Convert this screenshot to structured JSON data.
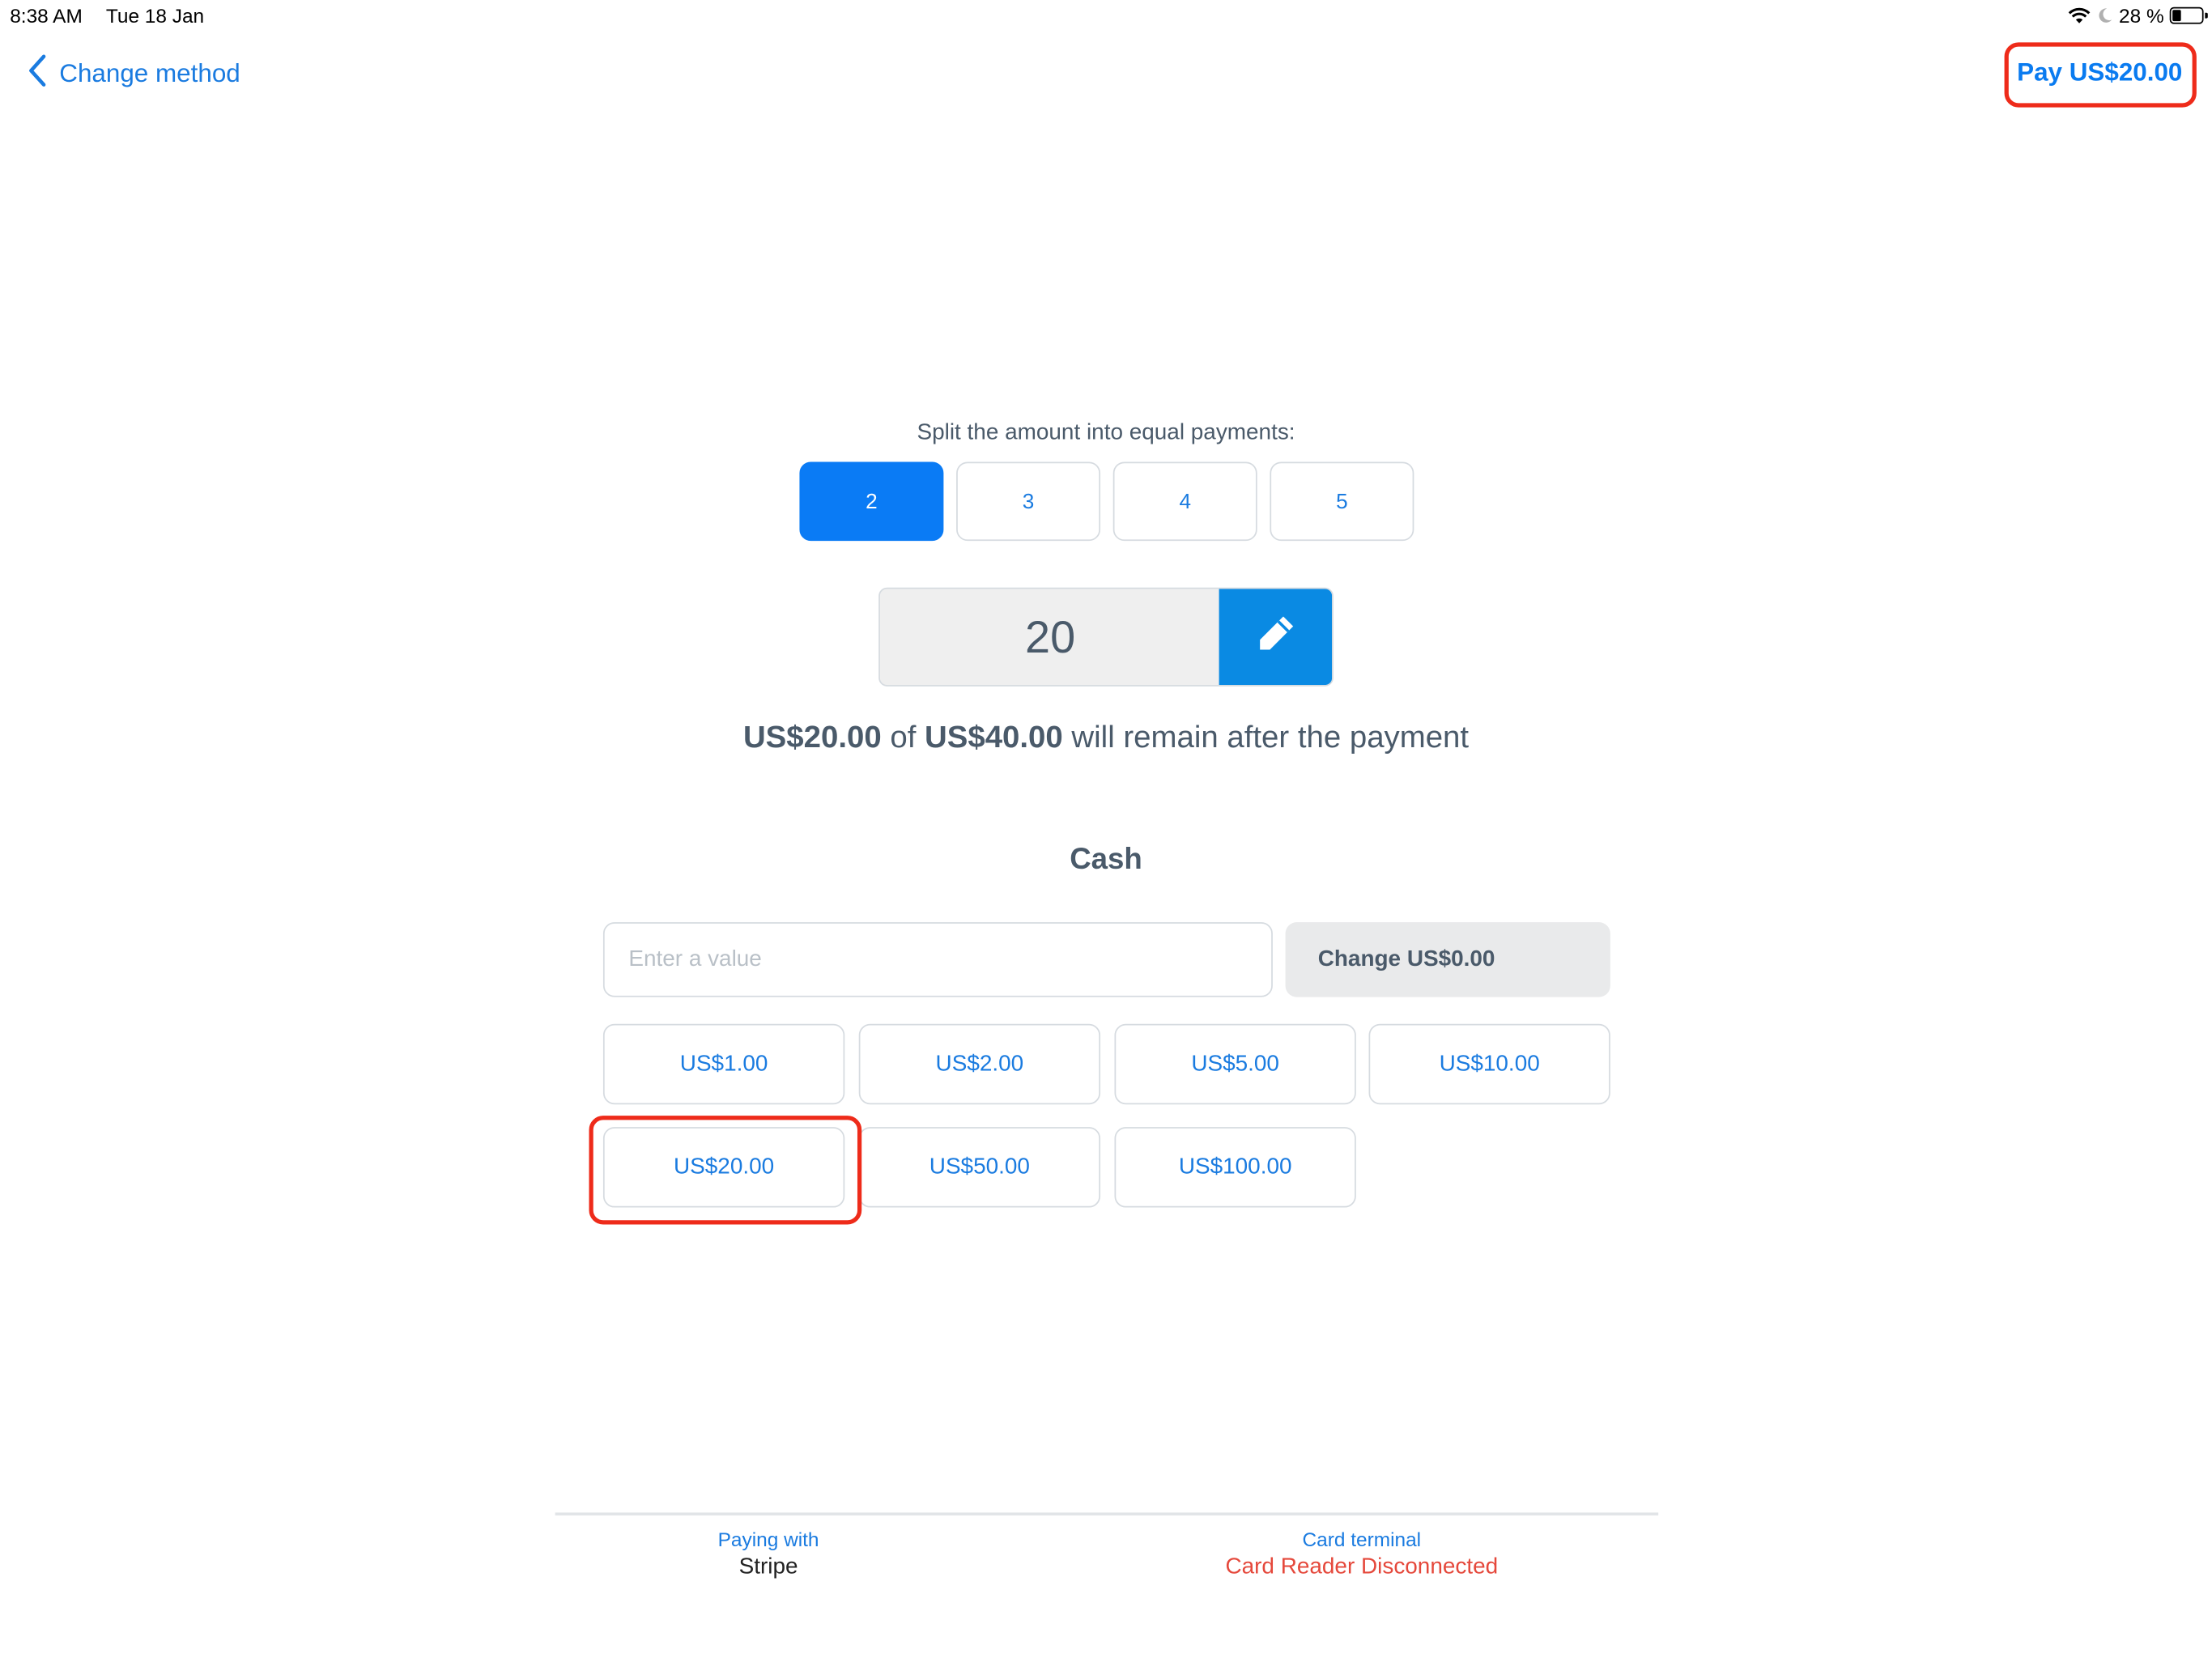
{
  "status_bar": {
    "time": "8:38 AM",
    "date": "Tue 18 Jan",
    "battery_text": "28 %"
  },
  "nav": {
    "back_label": "Change method",
    "pay_label": "Pay US$20.00"
  },
  "split": {
    "label": "Split the amount into equal payments:",
    "options": [
      "2",
      "3",
      "4",
      "5"
    ],
    "selected": "2"
  },
  "amount": {
    "value": "20"
  },
  "remain": {
    "amount": "US$20.00",
    "of_text": " of ",
    "total": "US$40.00",
    "suffix": " will remain after the payment"
  },
  "cash": {
    "title": "Cash",
    "input_placeholder": "Enter a value",
    "change_label": "Change US$0.00",
    "quick_amounts": [
      "US$1.00",
      "US$2.00",
      "US$5.00",
      "US$10.00",
      "US$20.00",
      "US$50.00",
      "US$100.00"
    ]
  },
  "footer": {
    "paying_with_label": "Paying with",
    "paying_with_value": "Stripe",
    "card_terminal_label": "Card terminal",
    "card_terminal_value": "Card Reader Disconnected"
  },
  "colors": {
    "accent": "#0a7bf5",
    "link": "#1a7be0",
    "text_muted": "#4a5a6a",
    "error": "#e5483b",
    "highlight": "#ee2b1a"
  }
}
